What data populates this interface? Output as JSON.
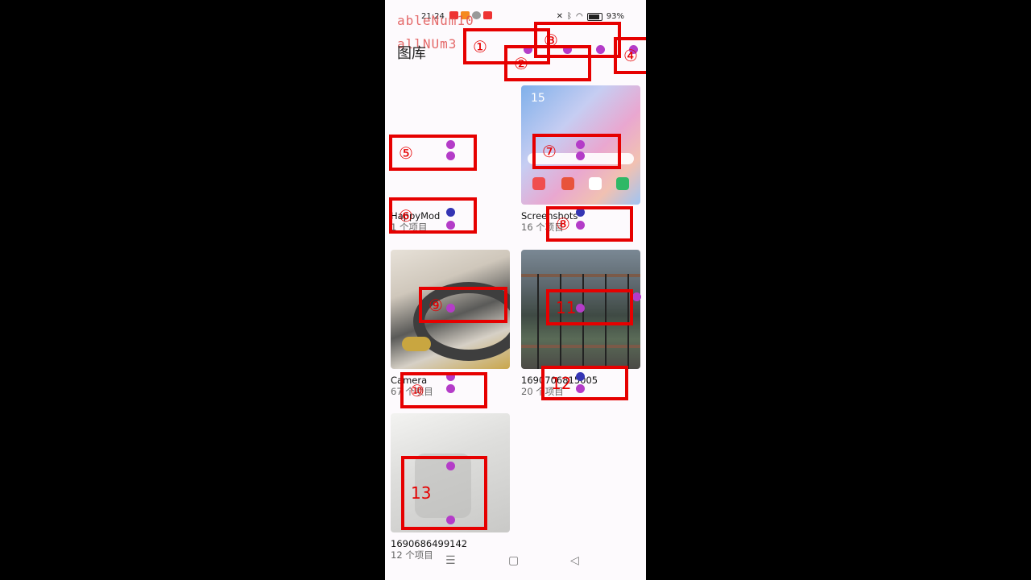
{
  "status": {
    "time": "21:24",
    "battery": "93%"
  },
  "overlay": {
    "line1": "ableNum10",
    "line2": "allNUm3"
  },
  "header": {
    "title": "图库"
  },
  "albums": [
    {
      "name": "HappyMod",
      "count": "1 个项目"
    },
    {
      "name": "Screenshots",
      "count": "16 个项目",
      "clock": "15"
    },
    {
      "name": "Camera",
      "count": "67 个项目"
    },
    {
      "name": "1690706815005",
      "count": "20 个项目"
    },
    {
      "name": "1690686499142",
      "count": "12 个项目"
    }
  ],
  "marks": [
    "①",
    "②",
    "③",
    "④",
    "⑤",
    "⑥",
    "⑦",
    "⑧",
    "⑨",
    "⑩",
    "11",
    "12",
    "13"
  ],
  "nav": {
    "menu": "☰",
    "home": "▢",
    "back": "◁"
  },
  "colors": {
    "mark": "#e60000",
    "dot": "#b43cc8",
    "dot_blue": "#3535b4"
  }
}
